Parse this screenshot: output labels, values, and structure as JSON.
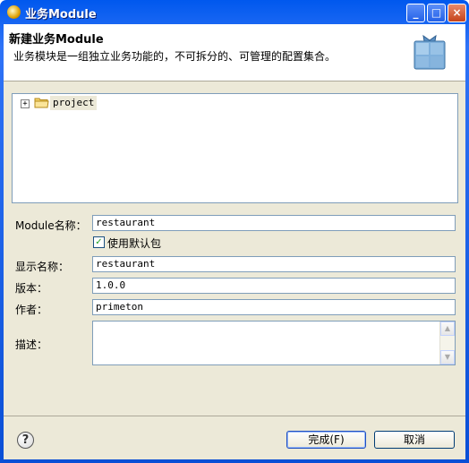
{
  "window": {
    "title": "业务Module"
  },
  "header": {
    "title": "新建业务Module",
    "description": "业务模块是一组独立业务功能的，不可拆分的、可管理的配置集合。"
  },
  "tree": {
    "items": [
      {
        "label": "project",
        "expander": "+"
      }
    ]
  },
  "form": {
    "module_name_label": "Module名称：",
    "module_name_value": "restaurant",
    "use_default_package_label": "使用默认包",
    "use_default_package_checked": true,
    "display_name_label": "显示名称：",
    "display_name_value": "restaurant",
    "version_label": "版本：",
    "version_value": "1.0.0",
    "author_label": "作者：",
    "author_value": "primeton",
    "description_label": "描述：",
    "description_value": ""
  },
  "buttons": {
    "finish": "完成(F)",
    "cancel": "取消",
    "help": "?"
  },
  "title_buttons": {
    "minimize": "_",
    "maximize": "□",
    "close": "×"
  },
  "icons": [
    "app-icon",
    "folder-icon",
    "help-icon",
    "wizard-banner-icon"
  ],
  "colors": {
    "titlebar": "#0a4fd6",
    "dialog_bg": "#ece9d8",
    "field_border": "#7f9db9"
  }
}
